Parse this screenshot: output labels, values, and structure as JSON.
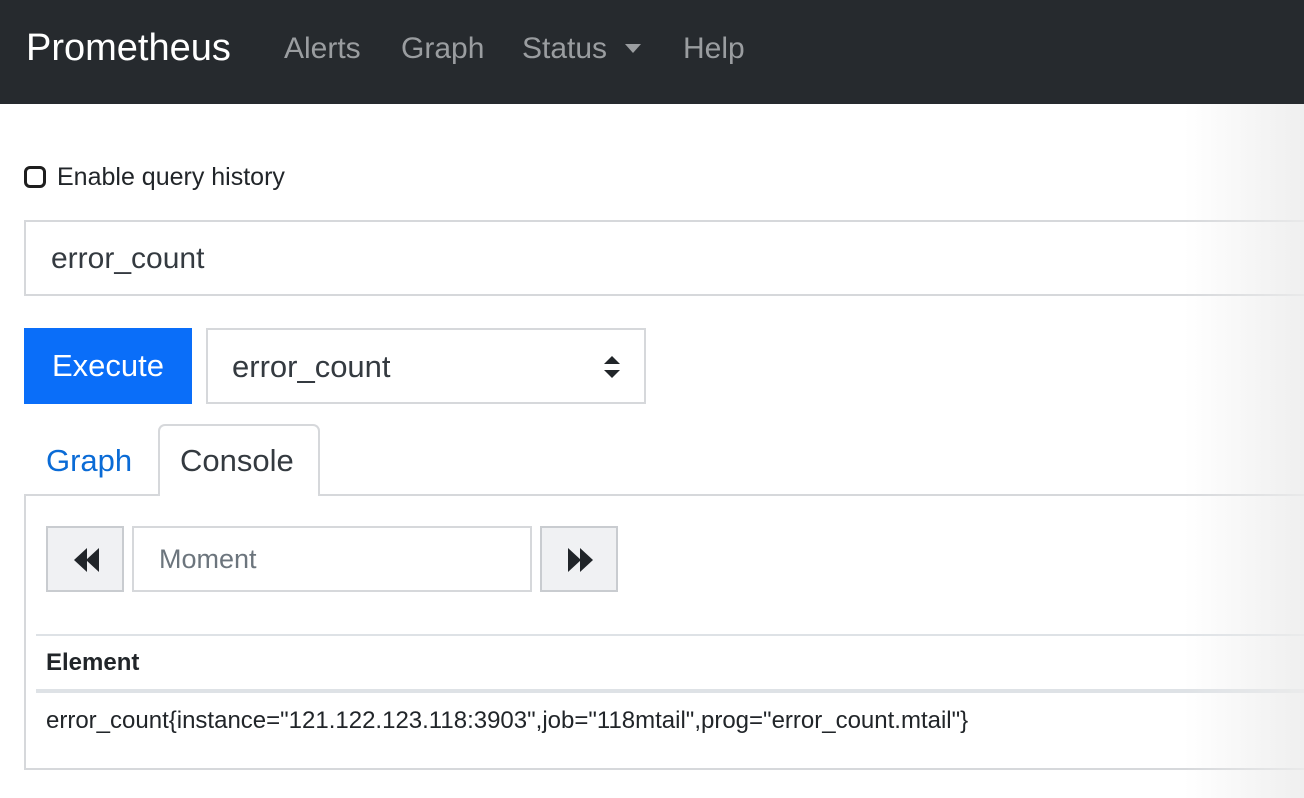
{
  "navbar": {
    "brand": "Prometheus",
    "links": [
      {
        "label": "Alerts"
      },
      {
        "label": "Graph"
      },
      {
        "label": "Status"
      },
      {
        "label": "Help"
      }
    ]
  },
  "query_history": {
    "label": "Enable query history",
    "checked": false
  },
  "expression": {
    "value": "error_count"
  },
  "execute_label": "Execute",
  "metric_select": {
    "selected": "error_count"
  },
  "tabs": [
    {
      "label": "Graph",
      "active": false
    },
    {
      "label": "Console",
      "active": true
    }
  ],
  "console": {
    "moment_placeholder": "Moment",
    "table": {
      "header": "Element",
      "rows": [
        {
          "element": "error_count{instance=\"121.122.123.118:3903\",job=\"118mtail\",prog=\"error_count.mtail\"}"
        }
      ]
    }
  },
  "colors": {
    "navbar_bg": "#262a2e",
    "execute_bg": "#0a6ef9",
    "link_blue": "#0a6bd6"
  },
  "icons": {
    "dropdown": "chevron-down-icon",
    "select": "updown-arrows-icon",
    "back": "fast-backward-icon",
    "forward": "fast-forward-icon"
  }
}
